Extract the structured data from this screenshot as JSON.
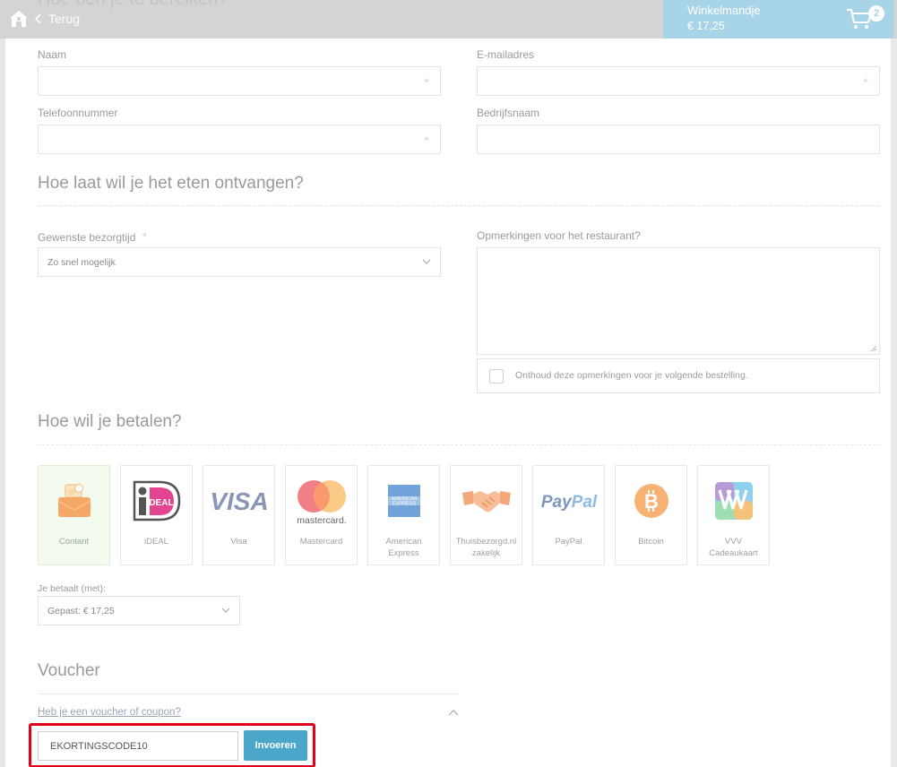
{
  "header": {
    "ghost_title": "Hoe ben je te bereiken?",
    "back_label": "Terug",
    "cart": {
      "title": "Winkelmandje",
      "total": "€ 17,25",
      "count": "2"
    }
  },
  "contact": {
    "name_label": "Naam",
    "email_label": "E-mailadres",
    "phone_label": "Telefoonnummer",
    "company_label": "Bedrijfsnaam",
    "required_mark": "*"
  },
  "timing": {
    "heading": "Hoe laat wil je het eten ontvangen?",
    "time_label": "Gewenste bezorgtijd",
    "time_value": "Zo snel mogelijk",
    "remarks_label": "Opmerkingen voor het restaurant?",
    "remember_label": "Onthoud deze opmerkingen voor je volgende bestelling."
  },
  "payment": {
    "heading": "Hoe wil je betalen?",
    "methods": [
      {
        "label": "Contant",
        "icon": "cash-icon",
        "selected": true
      },
      {
        "label": "iDEAL",
        "icon": "ideal-icon"
      },
      {
        "label": "Visa",
        "icon": "visa-icon"
      },
      {
        "label": "Mastercard",
        "icon": "mastercard-icon"
      },
      {
        "label": "American Express",
        "icon": "amex-icon"
      },
      {
        "label": "Thuisbezorgd.nl zakelijk",
        "icon": "handshake-icon"
      },
      {
        "label": "PayPal",
        "icon": "paypal-icon"
      },
      {
        "label": "Bitcoin",
        "icon": "bitcoin-icon"
      },
      {
        "label": "VVV Cadeaukaart",
        "icon": "vvv-icon"
      }
    ],
    "pay_with_label": "Je betaalt (met):",
    "pay_with_value": "Gepast: € 17,25"
  },
  "voucher": {
    "heading": "Voucher",
    "toggle_label": "Heb je een voucher of coupon?",
    "code_value": "EKORTINGSCODE10",
    "submit_label": "Invoeren"
  },
  "colors": {
    "accent": "#4aa7c9",
    "cart_bg": "#a8d4e8",
    "highlight": "#e0001b",
    "selected_bg": "#f3fbee"
  }
}
